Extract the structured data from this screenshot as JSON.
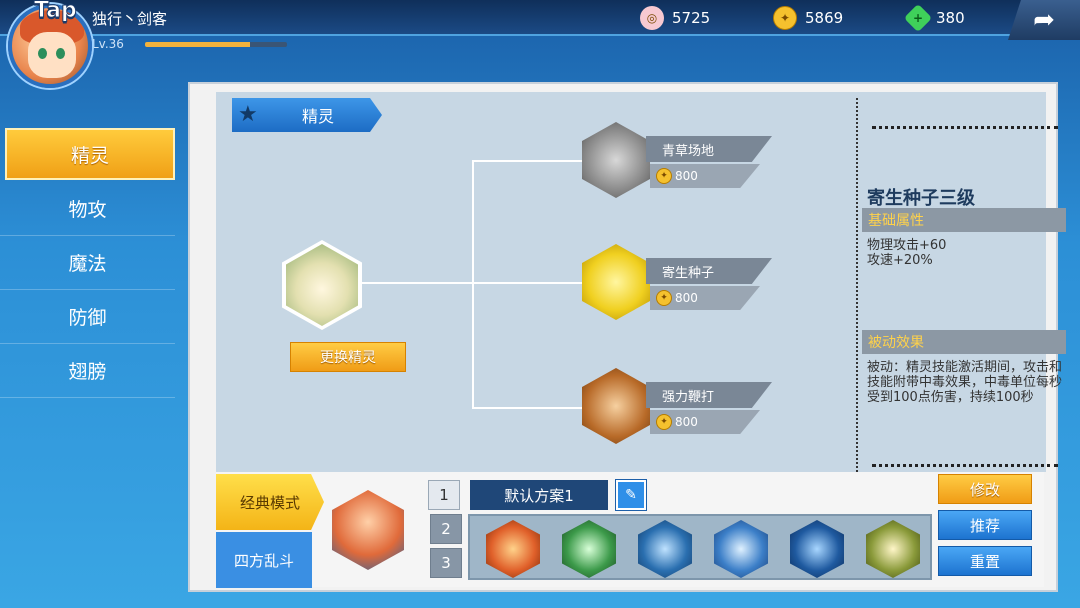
{
  "header": {
    "logo": "Tap",
    "player_name": "独行丶剑客",
    "level": "Lv.36",
    "xp_fraction": 0.74,
    "currencies": [
      {
        "icon": "shell-icon",
        "value": "5725",
        "color": "#f0c0c8"
      },
      {
        "icon": "gold-coin-icon",
        "value": "5869",
        "color": "#f5c12e"
      },
      {
        "icon": "green-gem-icon",
        "value": "380",
        "color": "#3fd05a"
      }
    ]
  },
  "sidebar": {
    "items": [
      {
        "label": "精灵",
        "active": true
      },
      {
        "label": "物攻",
        "active": false
      },
      {
        "label": "魔法",
        "active": false
      },
      {
        "label": "防御",
        "active": false
      },
      {
        "label": "翅膀",
        "active": false
      }
    ]
  },
  "panel": {
    "section_title": "精灵",
    "swap_button": "更换精灵",
    "skills": [
      {
        "name": "青草场地",
        "cost": "800",
        "color": "#7c7c7c"
      },
      {
        "name": "寄生种子",
        "cost": "800",
        "color": "#f0d020"
      },
      {
        "name": "强力鞭打",
        "cost": "800",
        "color": "#b86a28"
      }
    ],
    "detail": {
      "title": "寄生种子三级",
      "base_attr_label": "基础属性",
      "base_attrs": [
        "物理攻击+60",
        "攻速+20%"
      ],
      "passive_label": "被动效果",
      "passive_text": "被动：精灵技能激活期间，攻击和技能附带中毒效果，中毒单位每秒受到100点伤害，持续100秒"
    }
  },
  "loadout": {
    "modes": [
      "经典模式",
      "四方乱斗"
    ],
    "plan_numbers": [
      "1",
      "2",
      "3"
    ],
    "plan_name": "默认方案1",
    "slot_colors": [
      "#e0602a",
      "#3c9a4a",
      "#2a6fb0",
      "#3c7fc8",
      "#1f5aa0",
      "#8a9a3a"
    ],
    "actions": {
      "modify": "修改",
      "recommend": "推荐",
      "reset": "重置"
    }
  }
}
